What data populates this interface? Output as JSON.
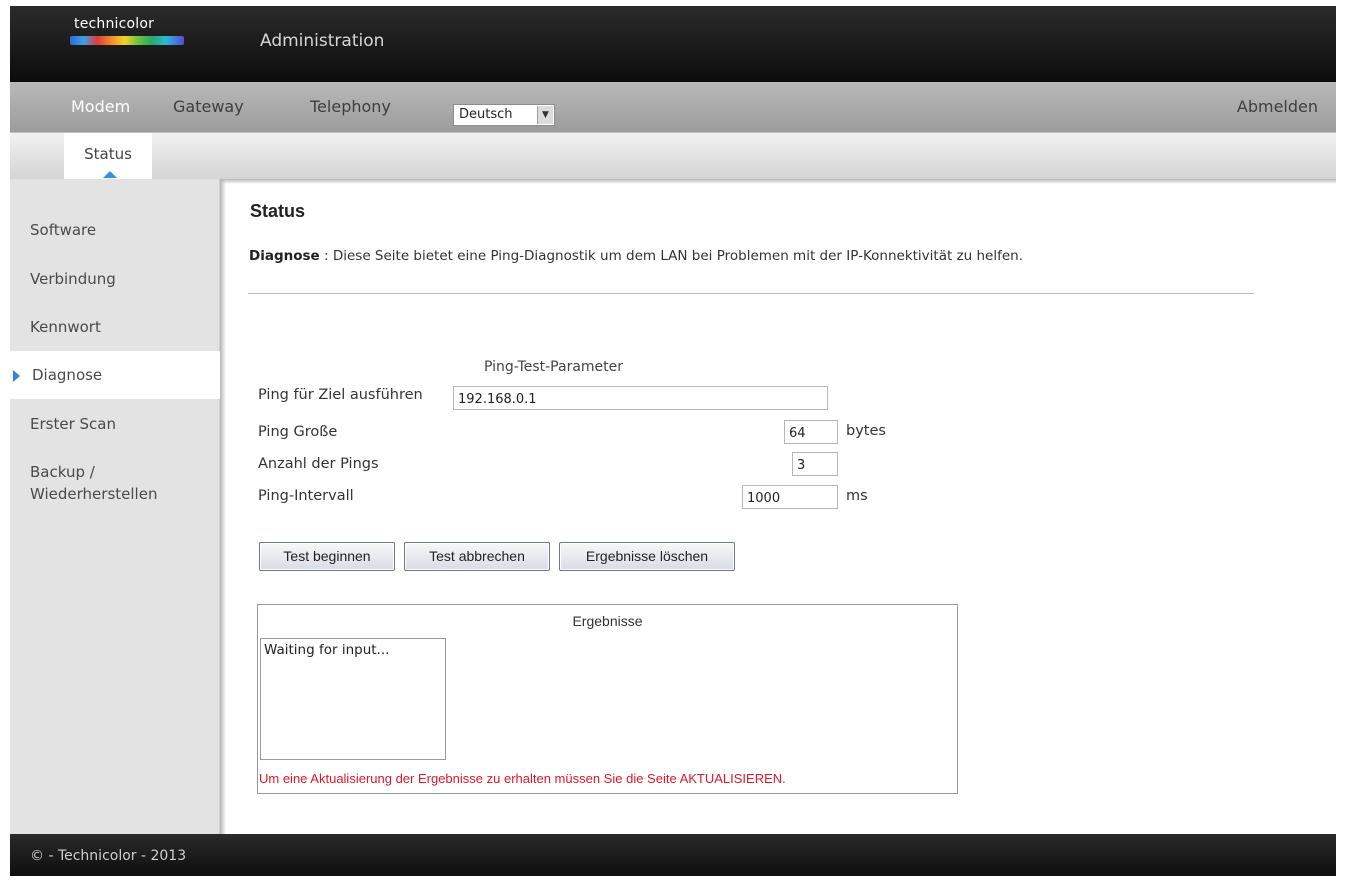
{
  "header": {
    "logo_text": "technicolor",
    "title": "Administration"
  },
  "nav": {
    "items": [
      {
        "label": "Modem",
        "active": true
      },
      {
        "label": "Gateway",
        "active": false
      },
      {
        "label": "Telephony",
        "active": false
      }
    ],
    "language": "Deutsch",
    "logout": "Abmelden"
  },
  "subnav": {
    "tabs": [
      {
        "label": "Status",
        "active": true
      }
    ]
  },
  "sidebar": {
    "items": [
      {
        "label": "Software"
      },
      {
        "label": "Verbindung"
      },
      {
        "label": "Kennwort"
      },
      {
        "label": "Diagnose",
        "active": true
      },
      {
        "label": "Erster Scan"
      },
      {
        "label": "Backup /"
      },
      {
        "label": "Wiederherstellen"
      }
    ]
  },
  "main": {
    "title": "Status",
    "description_label": "Diagnose",
    "description_sep": " : ",
    "description_text": "Diese Seite bietet eine Ping-Diagnostik um dem LAN bei Problemen mit der IP-Konnektivität zu helfen.",
    "params_title": "Ping-Test-Parameter",
    "params": {
      "target": {
        "label": "Ping für Ziel ausführen",
        "value": "192.168.0.1"
      },
      "size": {
        "label": "Ping Große",
        "value": "64",
        "unit": "bytes"
      },
      "count": {
        "label": "Anzahl der Pings",
        "value": "3"
      },
      "interval": {
        "label": "Ping-Intervall",
        "value": "1000",
        "unit": "ms"
      }
    },
    "buttons": {
      "start": "Test beginnen",
      "abort": "Test abbrechen",
      "clear": "Ergebnisse löschen"
    },
    "results": {
      "title": "Ergebnisse",
      "text": "Waiting for input...",
      "note": "Um eine Aktualisierung der Ergebnisse zu erhalten müssen Sie die Seite AKTUALISIEREN."
    }
  },
  "footer": {
    "text": "© - Technicolor - 2013"
  }
}
